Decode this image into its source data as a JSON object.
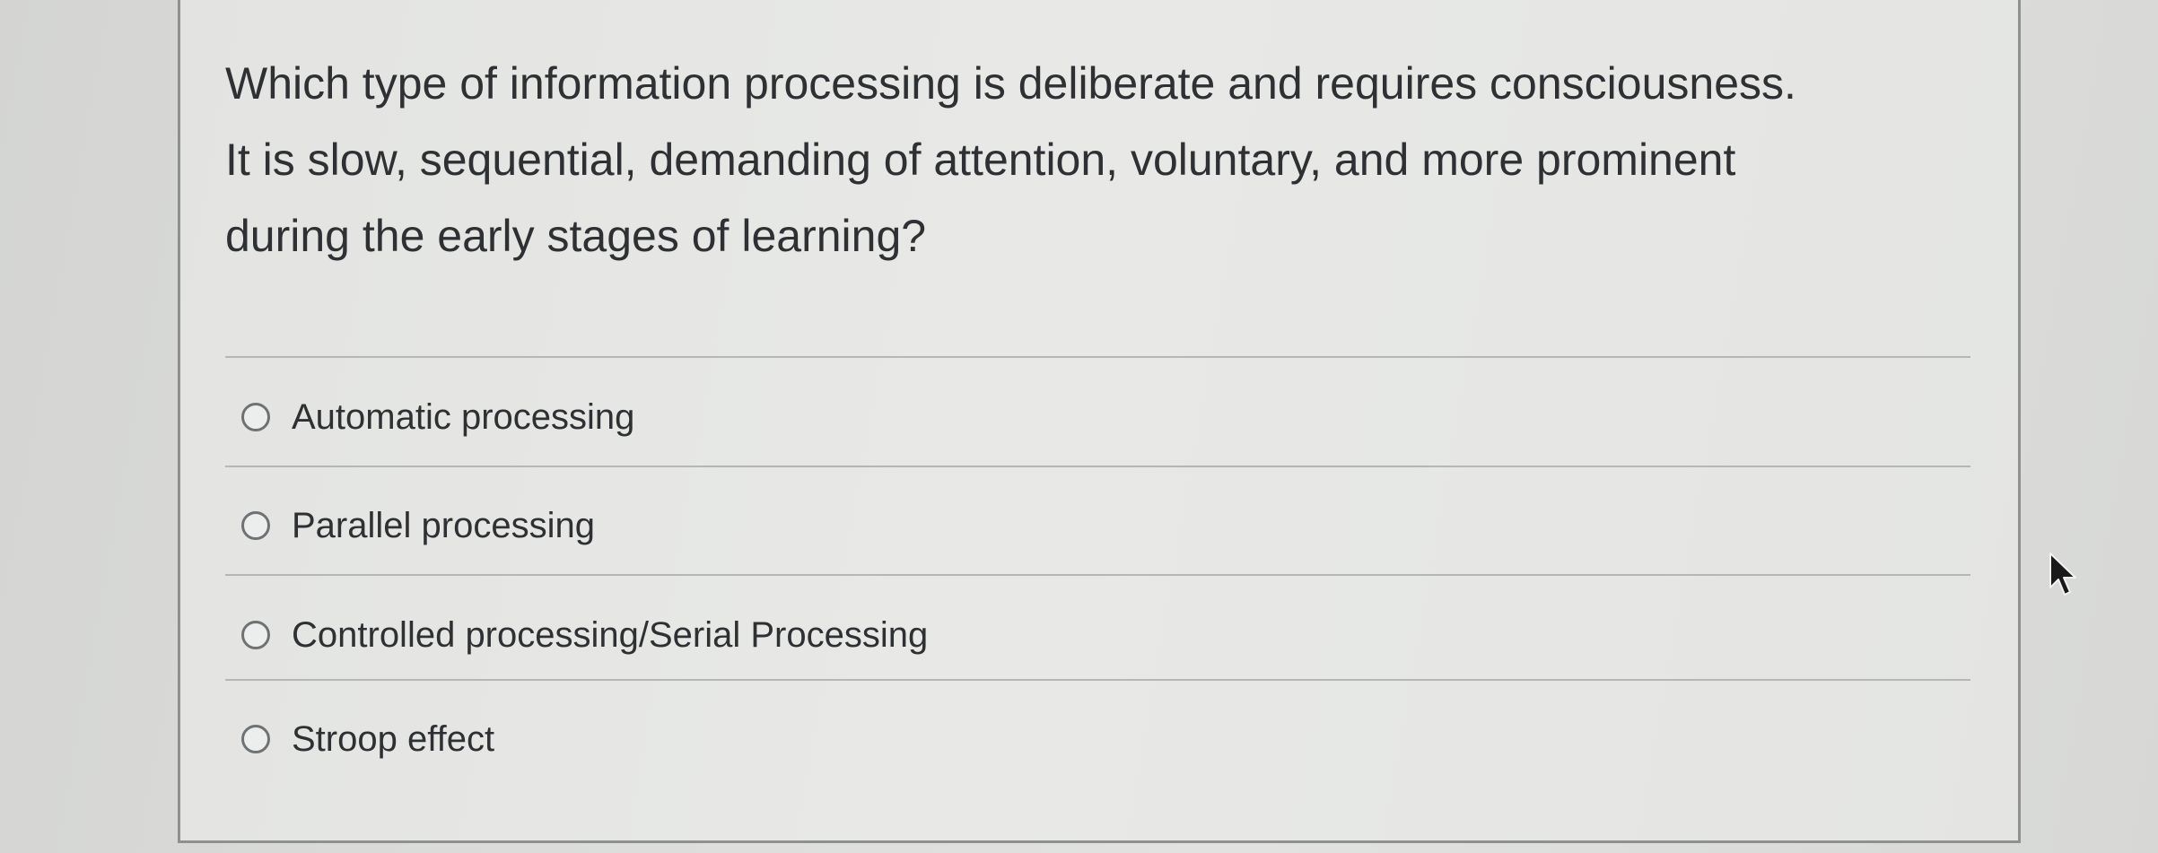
{
  "question": {
    "text": "Which type of information processing is deliberate and requires consciousness.\nIt is slow, sequential, demanding of attention, voluntary, and more prominent\nduring the early stages of learning?"
  },
  "options": [
    {
      "label": "Automatic processing",
      "selected": false
    },
    {
      "label": "Parallel processing",
      "selected": false
    },
    {
      "label": "Controlled processing/Serial Processing",
      "selected": false
    },
    {
      "label": "Stroop effect",
      "selected": false
    }
  ],
  "icons": {
    "radio": "radio-button-unselected-icon",
    "cursor": "mouse-pointer-icon"
  },
  "colors": {
    "text": "#2e3033",
    "border": "#8e918f",
    "background": "#e5e6e4"
  }
}
